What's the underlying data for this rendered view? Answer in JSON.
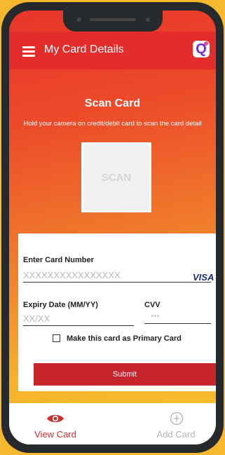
{
  "header": {
    "title": "My Card Details"
  },
  "scan": {
    "title": "Scan Card",
    "subtitle": "Hold your camera on credit/debit card to scan the card detail",
    "box_label": "SCAN"
  },
  "form": {
    "card_number_label": "Enter Card Number",
    "card_number_placeholder": "XXXXXXXXXXXXXXXX",
    "card_brand": "VISA",
    "expiry_label": "Expiry Date (MM/YY)",
    "expiry_placeholder": "XX/XX",
    "cvv_label": "CVV",
    "cvv_placeholder": "***",
    "primary_card_label": "Make this card as Primary Card",
    "primary_card_checked": false,
    "submit_label": "Submit"
  },
  "nav": {
    "items": [
      {
        "label": "View Card",
        "icon": "eye-icon",
        "active": true,
        "color": "#d42b2b"
      },
      {
        "label": "Add Card",
        "icon": "plus-circle-icon",
        "active": false,
        "color": "#b5b5b5"
      }
    ]
  },
  "colors": {
    "background": "#f5b82e",
    "header": "#e42c2b",
    "submit": "#c8242e",
    "brand": "#1a2a7a"
  }
}
